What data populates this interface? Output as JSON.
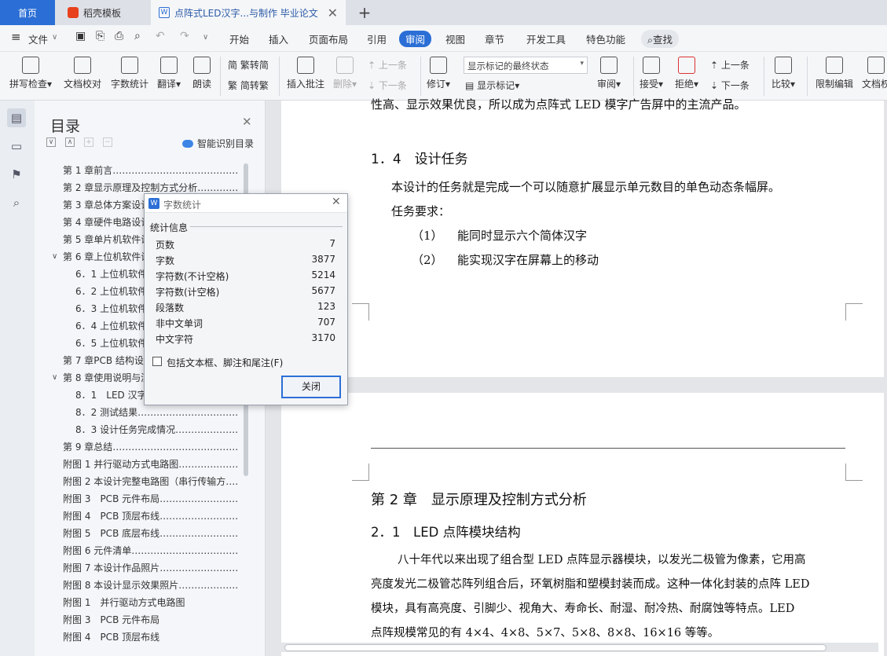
{
  "tabs": {
    "home": "首页",
    "template": "稻壳模板",
    "document": "点阵式LED汉字...与制作 毕业论文"
  },
  "menu": {
    "file": "文件",
    "items": [
      "开始",
      "插入",
      "页面布局",
      "引用",
      "审阅",
      "视图",
      "章节",
      "开发工具",
      "特色功能"
    ],
    "search": "查找"
  },
  "toolbar": {
    "spell": "拼写检查",
    "proof": "文档校对",
    "wordcount": "字数统计",
    "translate": "翻译",
    "read": "朗读",
    "trad": "繁转简",
    "simp": "简转繁",
    "insert_comment": "插入批注",
    "delete": "删除",
    "prev_comment": "上一条",
    "next_comment": "下一条",
    "revise": "修订",
    "mark_select": "显示标记的最终状态",
    "show_marks": "显示标记",
    "review": "审阅",
    "accept": "接受",
    "reject": "拒绝",
    "prev_change": "上一条",
    "next_change": "下一条",
    "compare": "比较",
    "restrict": "限制编辑",
    "protect": "文档权"
  },
  "toc": {
    "title": "目录",
    "smart": "智能识别目录",
    "items": [
      {
        "text": "第 1 章前言……………………………………………",
        "indent": 0
      },
      {
        "text": "第 2 章显示原理及控制方式分析…………………………",
        "indent": 0
      },
      {
        "text": "第 3 章总体方案设计……………………………",
        "indent": 0
      },
      {
        "text": "第 4 章硬件电路设计……………………………",
        "indent": 0
      },
      {
        "text": "第 5 章单片机软件设计…………………………",
        "indent": 0
      },
      {
        "text": "第 6 章上位机软件设计…………………………",
        "indent": 0,
        "arrow": "∨"
      },
      {
        "text": "6．1 上位机软件……………………………",
        "indent": 1
      },
      {
        "text": "6．2 上位机软件……………………………",
        "indent": 1
      },
      {
        "text": "6．3 上位机软件……………………………",
        "indent": 1
      },
      {
        "text": "6．4 上位机软件……………………………",
        "indent": 1
      },
      {
        "text": "6．5 上位机软件……………………………",
        "indent": 1
      },
      {
        "text": "第 7 章PCB 结构设计……………………………",
        "indent": 0
      },
      {
        "text": "第 8 章使用说明与测试…………………………",
        "indent": 0,
        "arrow": "∨"
      },
      {
        "text": "8．1　LED 汉字……………………………",
        "indent": 1
      },
      {
        "text": "8．2 测试结果……………………………………………",
        "indent": 1
      },
      {
        "text": "8．3 设计任务完成情况…………………………………",
        "indent": 1
      },
      {
        "text": "第 9 章总结…………………………………………………",
        "indent": 0
      },
      {
        "text": "附图 1 并行驱动方式电路图…………………………",
        "indent": 0
      },
      {
        "text": "附图 2 本设计完整电路图（串行传输方……",
        "indent": 0
      },
      {
        "text": "附图 3　PCB 元件布局……………………………………",
        "indent": 0
      },
      {
        "text": "附图 4　PCB 顶层布线……………………………………",
        "indent": 0
      },
      {
        "text": "附图 5　PCB 底层布线……………………………………",
        "indent": 0
      },
      {
        "text": "附图 6 元件清单…………………………………………",
        "indent": 0
      },
      {
        "text": "附图 7 本设计作品照片…………………………………",
        "indent": 0
      },
      {
        "text": "附图 8 本设计显示效果照片……………………………",
        "indent": 0
      },
      {
        "text": "附图 1　并行驱动方式电路图",
        "indent": 0
      },
      {
        "text": "附图 3　PCB 元件布局",
        "indent": 0
      },
      {
        "text": "附图 4　PCB 顶层布线",
        "indent": 0
      }
    ]
  },
  "doc": {
    "top_line": "性高、显示效果优良，所以成为点阵式 LED 模字广告屏中的主流产品。",
    "s14_title": "1．4　设计任务",
    "s14_p1": "本设计的任务就是完成一个可以随意扩展显示单元数目的单色动态条幅屏。",
    "s14_p2": "任务要求：",
    "req1_num": "（1）",
    "req1": "能同时显示六个简体汉字",
    "req2_num": "（2）",
    "req2": "能实现汉字在屏幕上的移动",
    "ch2_title": "第 2 章　显示原理及控制方式分析",
    "s21_title": "2．1　LED 点阵模块结构",
    "p1": "八十年代以来出现了组合型 LED 点阵显示器模块，以发光二极管为像素，它用高",
    "p2": "亮度发光二极管芯阵列组合后，环氧树脂和塑模封装而成。这种一体化封装的点阵 LED",
    "p3": "模块，具有高亮度、引脚少、视角大、寿命长、耐湿、耐冷热、耐腐蚀等特点。LED",
    "p4": "点阵规模常见的有 4×4、4×8、5×7、5×8、8×8、16×16 等等。"
  },
  "dialog": {
    "title": "字数统计",
    "group": "统计信息",
    "stats": [
      {
        "label": "页数",
        "value": "7"
      },
      {
        "label": "字数",
        "value": "3877"
      },
      {
        "label": "字符数(不计空格)",
        "value": "5214"
      },
      {
        "label": "字符数(计空格)",
        "value": "5677"
      },
      {
        "label": "段落数",
        "value": "123"
      },
      {
        "label": "非中文单词",
        "value": "707"
      },
      {
        "label": "中文字符",
        "value": "3170"
      }
    ],
    "checkbox": "包括文本框、脚注和尾注(F)",
    "close": "关闭"
  },
  "colors": {
    "accent": "#2b6fd6",
    "template_icon": "#e8411d"
  }
}
